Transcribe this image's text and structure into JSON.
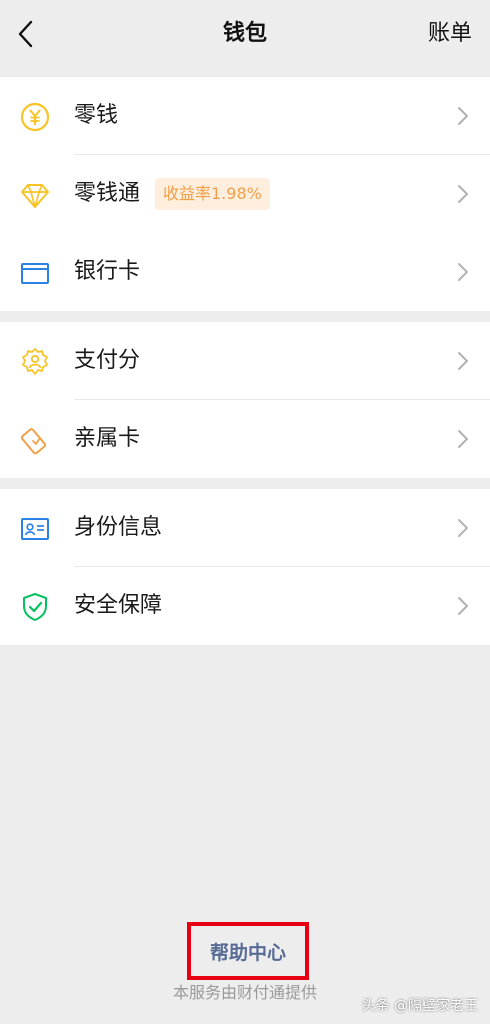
{
  "header": {
    "title": "钱包",
    "bill_label": "账单"
  },
  "groups": [
    {
      "items": [
        {
          "label": "零钱",
          "icon": "yuan-coin-icon"
        },
        {
          "label": "零钱通",
          "icon": "diamond-icon",
          "badge": "收益率1.98%"
        },
        {
          "label": "银行卡",
          "icon": "bank-card-icon"
        }
      ]
    },
    {
      "items": [
        {
          "label": "支付分",
          "icon": "badge-score-icon"
        },
        {
          "label": "亲属卡",
          "icon": "family-card-icon"
        }
      ]
    },
    {
      "items": [
        {
          "label": "身份信息",
          "icon": "id-card-icon"
        },
        {
          "label": "安全保障",
          "icon": "shield-check-icon"
        }
      ]
    }
  ],
  "footer": {
    "help_label": "帮助中心",
    "provider_text": "本服务由财付通提供"
  },
  "watermark": "头条 @隔壁家老王",
  "colors": {
    "background": "#ededed",
    "card": "#ffffff",
    "gold": "#f7c325",
    "blue": "#2a82e4",
    "orange": "#f2a24a",
    "green": "#07c160",
    "link": "#576b95",
    "highlight_border": "#e60012"
  }
}
